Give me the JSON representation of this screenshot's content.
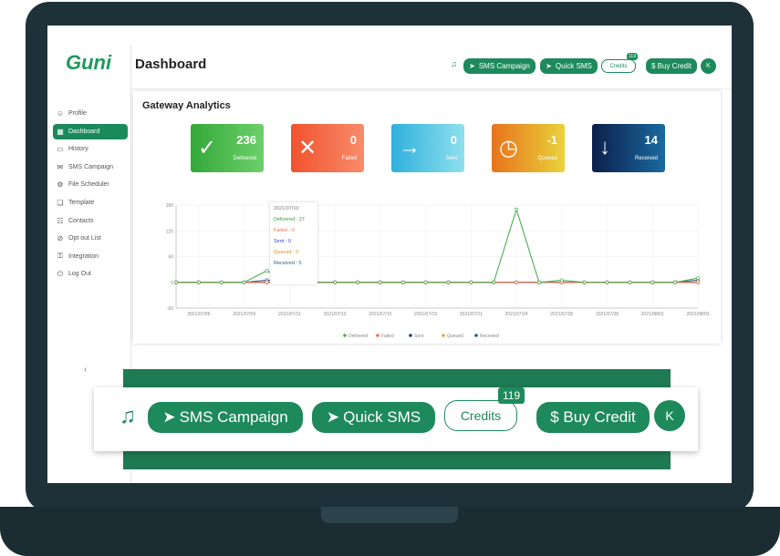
{
  "app": {
    "logo": "Guni",
    "title": "Dashboard"
  },
  "sidebar": {
    "items": [
      {
        "label": "Profile",
        "icon": "user-icon",
        "glyph": "☺"
      },
      {
        "label": "Dashboard",
        "icon": "dashboard-icon",
        "glyph": "▦",
        "active": true
      },
      {
        "label": "History",
        "icon": "history-icon",
        "glyph": "▭"
      },
      {
        "label": "SMS Campaign",
        "icon": "mail-icon",
        "glyph": "✉"
      },
      {
        "label": "File Scheduler",
        "icon": "scheduler-icon",
        "glyph": "⚙"
      },
      {
        "label": "Template",
        "icon": "template-icon",
        "glyph": "❏"
      },
      {
        "label": "Contacts",
        "icon": "contacts-icon",
        "glyph": "☷"
      },
      {
        "label": "Opt out List",
        "icon": "opt-out-icon",
        "glyph": "⊘"
      },
      {
        "label": "Integration",
        "icon": "integration-icon",
        "glyph": "⚿"
      },
      {
        "label": "Log Out",
        "icon": "logout-icon",
        "glyph": "⏻"
      }
    ],
    "collapse": "‹"
  },
  "header": {
    "bell": "🔔",
    "sms_campaign": "SMS Campaign",
    "quick_sms": "Quick SMS",
    "credits": "Credits",
    "credits_count": "119",
    "buy_credit": "$ Buy Credit",
    "avatar": "K",
    "send_glyph": "➤"
  },
  "analytics": {
    "title": "Gateway Analytics",
    "stats": [
      {
        "label": "Delivered",
        "value": "236",
        "glyph": "✓",
        "color1": "#34a83a",
        "color2": "#6cd06a"
      },
      {
        "label": "Failed",
        "value": "0",
        "glyph": "✕",
        "color1": "#f0522e",
        "color2": "#f98c6a"
      },
      {
        "label": "Sent",
        "value": "0",
        "glyph": "→",
        "color1": "#2fb0dc",
        "color2": "#8fe0ee"
      },
      {
        "label": "Queued",
        "value": "-1",
        "glyph": "◷",
        "color1": "#e8731c",
        "color2": "#e8d23a"
      },
      {
        "label": "Received",
        "value": "14",
        "glyph": "↓",
        "color1": "#0c1f4a",
        "color2": "#1a6aa0"
      }
    ]
  },
  "tooltip": {
    "date": "2021/07/10",
    "lines": [
      "Delivered : 27",
      "Failed : 0",
      "Sent : 0",
      "Queued : 0",
      "Received : 5"
    ]
  },
  "chart_data": {
    "type": "line",
    "ylim": [
      -60,
      180
    ],
    "yticks": [
      -60,
      0,
      60,
      120,
      180
    ],
    "grid": true,
    "legend": "bottom",
    "xticklabels": [
      "2021/07/06",
      "2021/07/09",
      "2021/07/11",
      "2021/07/13",
      "2021/07/15",
      "2021/07/19",
      "2021/07/21",
      "2021/07/24",
      "2021/07/26",
      "2021/07/28",
      "2021/08/01",
      "2021/08/03"
    ],
    "series": [
      {
        "name": "Delivered",
        "color": "#4caf50",
        "values": [
          0,
          0,
          0,
          0,
          27,
          0,
          0,
          0,
          0,
          0,
          0,
          0,
          0,
          0,
          0,
          170,
          0,
          5,
          0,
          0,
          0,
          0,
          0,
          10
        ]
      },
      {
        "name": "Failed",
        "color": "#f07050",
        "values": [
          0,
          0,
          0,
          0,
          0,
          0,
          0,
          0,
          0,
          0,
          0,
          0,
          0,
          0,
          0,
          0,
          0,
          0,
          0,
          0,
          0,
          0,
          0,
          0
        ]
      },
      {
        "name": "Sent",
        "color": "#1a3d8a",
        "values": [
          0,
          0,
          0,
          0,
          0,
          0,
          0,
          0,
          0,
          0,
          0,
          0,
          0,
          0,
          0,
          0,
          0,
          0,
          0,
          0,
          0,
          0,
          0,
          0
        ]
      },
      {
        "name": "Queued",
        "color": "#f0a030",
        "values": [
          0,
          0,
          0,
          0,
          0,
          0,
          0,
          0,
          0,
          0,
          0,
          0,
          0,
          0,
          0,
          0,
          0,
          0,
          0,
          0,
          0,
          0,
          0,
          0
        ]
      },
      {
        "name": "Received",
        "color": "#2a5f7a",
        "values": [
          0,
          0,
          0,
          0,
          5,
          0,
          0,
          0,
          0,
          0,
          0,
          0,
          0,
          0,
          0,
          0,
          0,
          0,
          0,
          0,
          0,
          0,
          0,
          5
        ]
      }
    ]
  }
}
